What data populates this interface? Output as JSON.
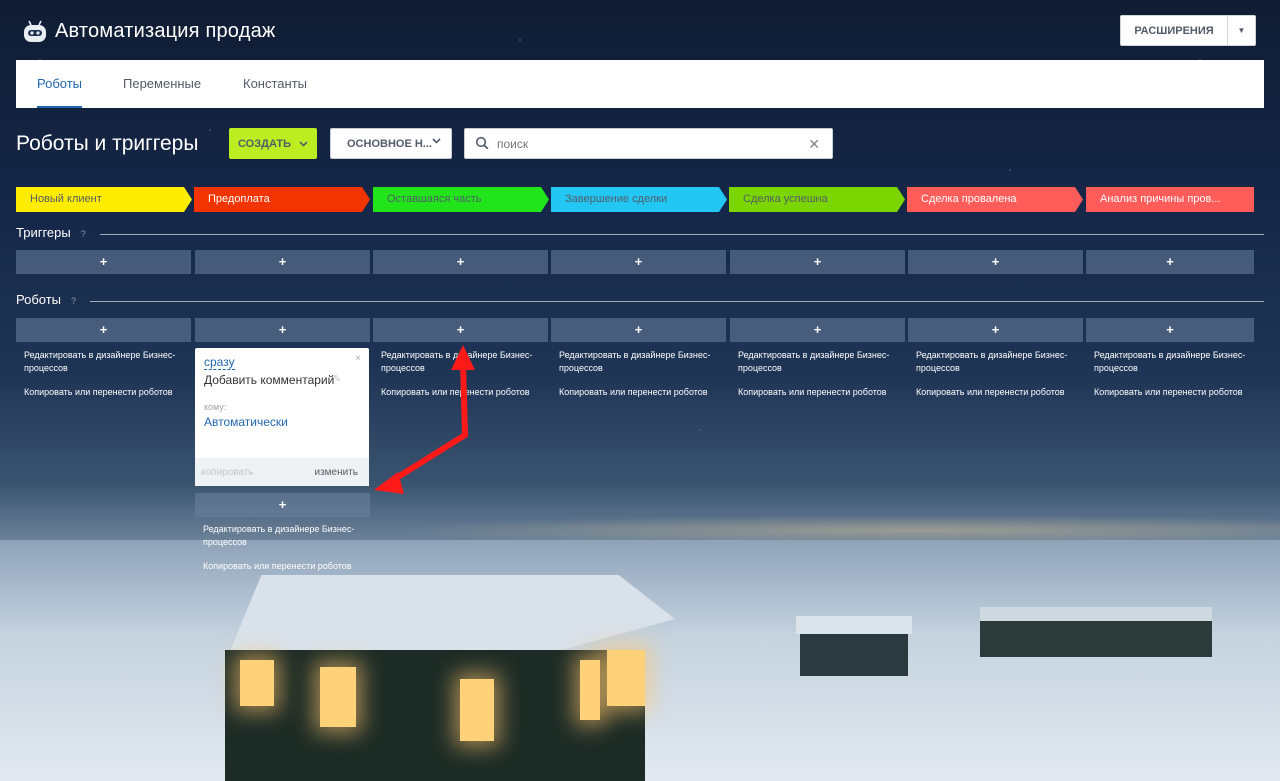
{
  "app": {
    "title": "Автоматизация продаж",
    "extensions_label": "РАСШИРЕНИЯ"
  },
  "tabs": [
    {
      "label": "Роботы",
      "active": true
    },
    {
      "label": "Переменные",
      "active": false
    },
    {
      "label": "Константы",
      "active": false
    }
  ],
  "toolbar": {
    "section_title": "Роботы и триггеры",
    "create_label": "СОЗДАТЬ",
    "filter_label": "ОСНОВНОЕ Н...",
    "search_placeholder": "поиск"
  },
  "stages": [
    {
      "label": "Новый клиент",
      "color": "#ffed00",
      "text_color": "#535c69"
    },
    {
      "label": "Предоплата",
      "color": "#f23500",
      "text_color": "#ffffff"
    },
    {
      "label": "Оставшаяся часть",
      "color": "#21e51a",
      "text_color": "#535c69"
    },
    {
      "label": "Завершение сделки",
      "color": "#22c7f3",
      "text_color": "#535c69"
    },
    {
      "label": "Сделка успешна",
      "color": "#7bd500",
      "text_color": "#535c69"
    },
    {
      "label": "Сделка провалена",
      "color": "#ff5c5a",
      "text_color": "#ffffff"
    },
    {
      "label": "Анализ причины пров...",
      "color": "#ff5c5a",
      "text_color": "#ffffff"
    }
  ],
  "triggers": {
    "title": "Триггеры",
    "help": "?",
    "add_symbol": "+"
  },
  "robots": {
    "title": "Роботы",
    "help": "?",
    "add_symbol": "+",
    "edit_in_designer": "Редактировать в дизайнере Бизнес-процессов",
    "copy_or_move": "Копировать или перенести роботов"
  },
  "robot_card": {
    "when": "сразу",
    "name": "Добавить комментарий",
    "to_label": "кому:",
    "to_value": "Автоматически",
    "copy_label": "копировать",
    "edit_label": "изменить",
    "close_symbol": "×"
  },
  "annotation": {
    "color": "#ff1a1a"
  }
}
